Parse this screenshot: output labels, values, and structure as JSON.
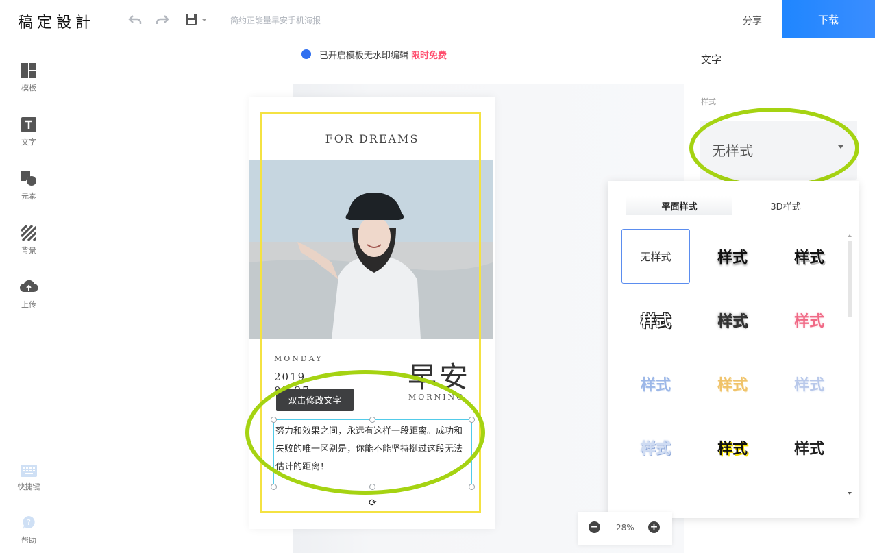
{
  "app": {
    "logo": "稿定設計"
  },
  "toolbar": {
    "doc_title": "简约正能量早安手机海报",
    "share_label": "分享",
    "download_label": "下载"
  },
  "sidebar": {
    "items": [
      {
        "label": "模板",
        "icon": "template-icon"
      },
      {
        "label": "文字",
        "icon": "text-icon"
      },
      {
        "label": "元素",
        "icon": "element-icon"
      },
      {
        "label": "背景",
        "icon": "background-icon"
      },
      {
        "label": "上传",
        "icon": "upload-icon"
      }
    ],
    "bottom": [
      {
        "label": "快捷键",
        "icon": "keyboard-icon"
      },
      {
        "label": "帮助",
        "icon": "help-icon"
      }
    ]
  },
  "notice": {
    "text": "已开启模板无水印编辑",
    "highlight": "限时免费"
  },
  "poster": {
    "title": "FOR DREAMS",
    "day": "MONDAY",
    "date": "2019.",
    "date2": "05.27",
    "greeting": "早安",
    "morning": "MORNING",
    "body": "努力和效果之间，永远有这样一段距离。成功和失败的唯一区别是，你能不能坚持挺过这段无法估计的距离！",
    "edit_tip": "双击修改文字"
  },
  "right_panel": {
    "title": "文字",
    "style_label": "样式",
    "style_value": "无样式",
    "tabs": [
      "平面样式",
      "3D样式"
    ],
    "styles": [
      {
        "label": "无样式",
        "color": "#333333"
      },
      {
        "label": "样式",
        "color": "#111111"
      },
      {
        "label": "样式",
        "color": "#111111"
      },
      {
        "label": "样式",
        "color": "#222222"
      },
      {
        "label": "样式",
        "color": "#333333"
      },
      {
        "label": "样式",
        "color": "#f06a86"
      },
      {
        "label": "样式",
        "color": "#9db8e8"
      },
      {
        "label": "样式",
        "color": "#f0c36a"
      },
      {
        "label": "样式",
        "color": "#b8c8ea"
      },
      {
        "label": "样式",
        "color": "#cfdcf3"
      },
      {
        "label": "样式",
        "color": "#111111"
      },
      {
        "label": "样式",
        "color": "#222222"
      }
    ]
  },
  "zoom": {
    "value": "28%"
  },
  "colors": {
    "accent": "#1f86ff",
    "highlight_ellipse": "#a5d312",
    "selection_frame": "#f4e242"
  }
}
